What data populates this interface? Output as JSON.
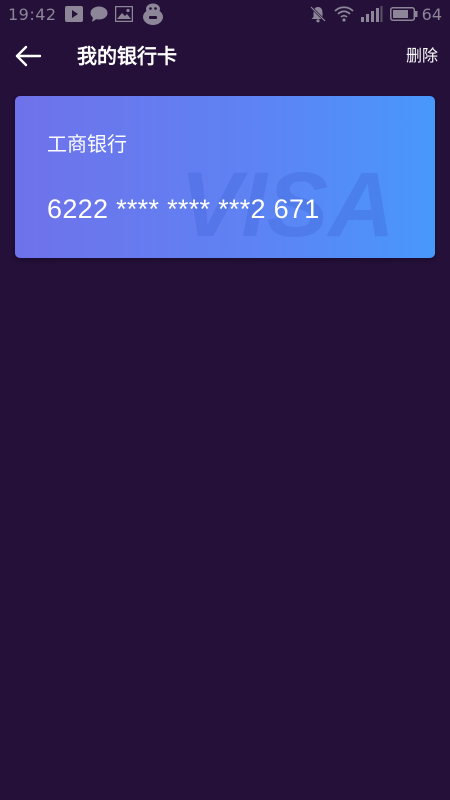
{
  "status_bar": {
    "time": "19:42",
    "battery": "64",
    "icons": [
      "play-icon",
      "chat-bubble-icon",
      "image-icon",
      "app-mascot-icon",
      "notifications-off-icon",
      "wifi-icon",
      "signal-icon",
      "battery-icon"
    ]
  },
  "header": {
    "title": "我的银行卡",
    "back_icon": "arrow-left-icon",
    "delete_label": "删除"
  },
  "card": {
    "bank_name": "工商银行",
    "number": "6222 **** **** ***2 671",
    "watermark": "VISA",
    "gradient": [
      "#6f72ea",
      "#4898fb"
    ]
  },
  "colors": {
    "background": "#241038",
    "status_text": "#8d8699",
    "text": "#ffffff"
  }
}
